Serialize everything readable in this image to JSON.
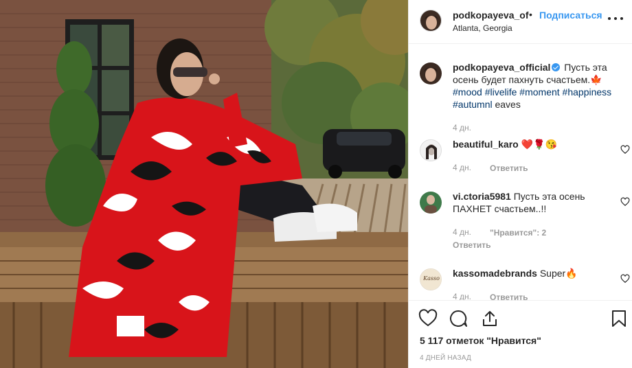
{
  "header": {
    "username": "podkopayeva_of",
    "separator": "•",
    "follow_label": "Подписаться",
    "location": "Atlanta, Georgia"
  },
  "caption": {
    "username": "podkopayeva_official",
    "line1": "Пусть эта",
    "line2": "осень будет пахнуть счастьем.",
    "emoji": "🍁",
    "tags": [
      "#mood",
      "#livelife",
      "#moment",
      "#happiness",
      "#autumnl"
    ],
    "trailing": "eaves",
    "time": "4 дн."
  },
  "comments": [
    {
      "username": "beautiful_karo",
      "text": "❤️🌹😘",
      "time": "4 дн.",
      "reply": "Ответить"
    },
    {
      "username": "vi.ctoria5981",
      "text_line1": "Пусть эта осень",
      "text_line2": "ПАХНЕТ счастьем..!!",
      "time": "4 дн.",
      "likes": "\"Нравится\": 2",
      "reply": "Ответить"
    },
    {
      "username": "kassomadebrands",
      "text": "Super🔥",
      "time": "4 дн.",
      "reply": "Ответить"
    }
  ],
  "avatar_kasso_text": "Kasso",
  "footer": {
    "likes": "5 117 отметок \"Нравится\"",
    "date": "4 ДНЕЙ НАЗАД"
  },
  "icons": [
    "heart-icon",
    "comment-icon",
    "share-icon",
    "bookmark-icon",
    "more-icon"
  ],
  "colors": {
    "accent": "#3897f0",
    "hashtag": "#003569",
    "muted": "#999999",
    "border": "#efefef"
  }
}
